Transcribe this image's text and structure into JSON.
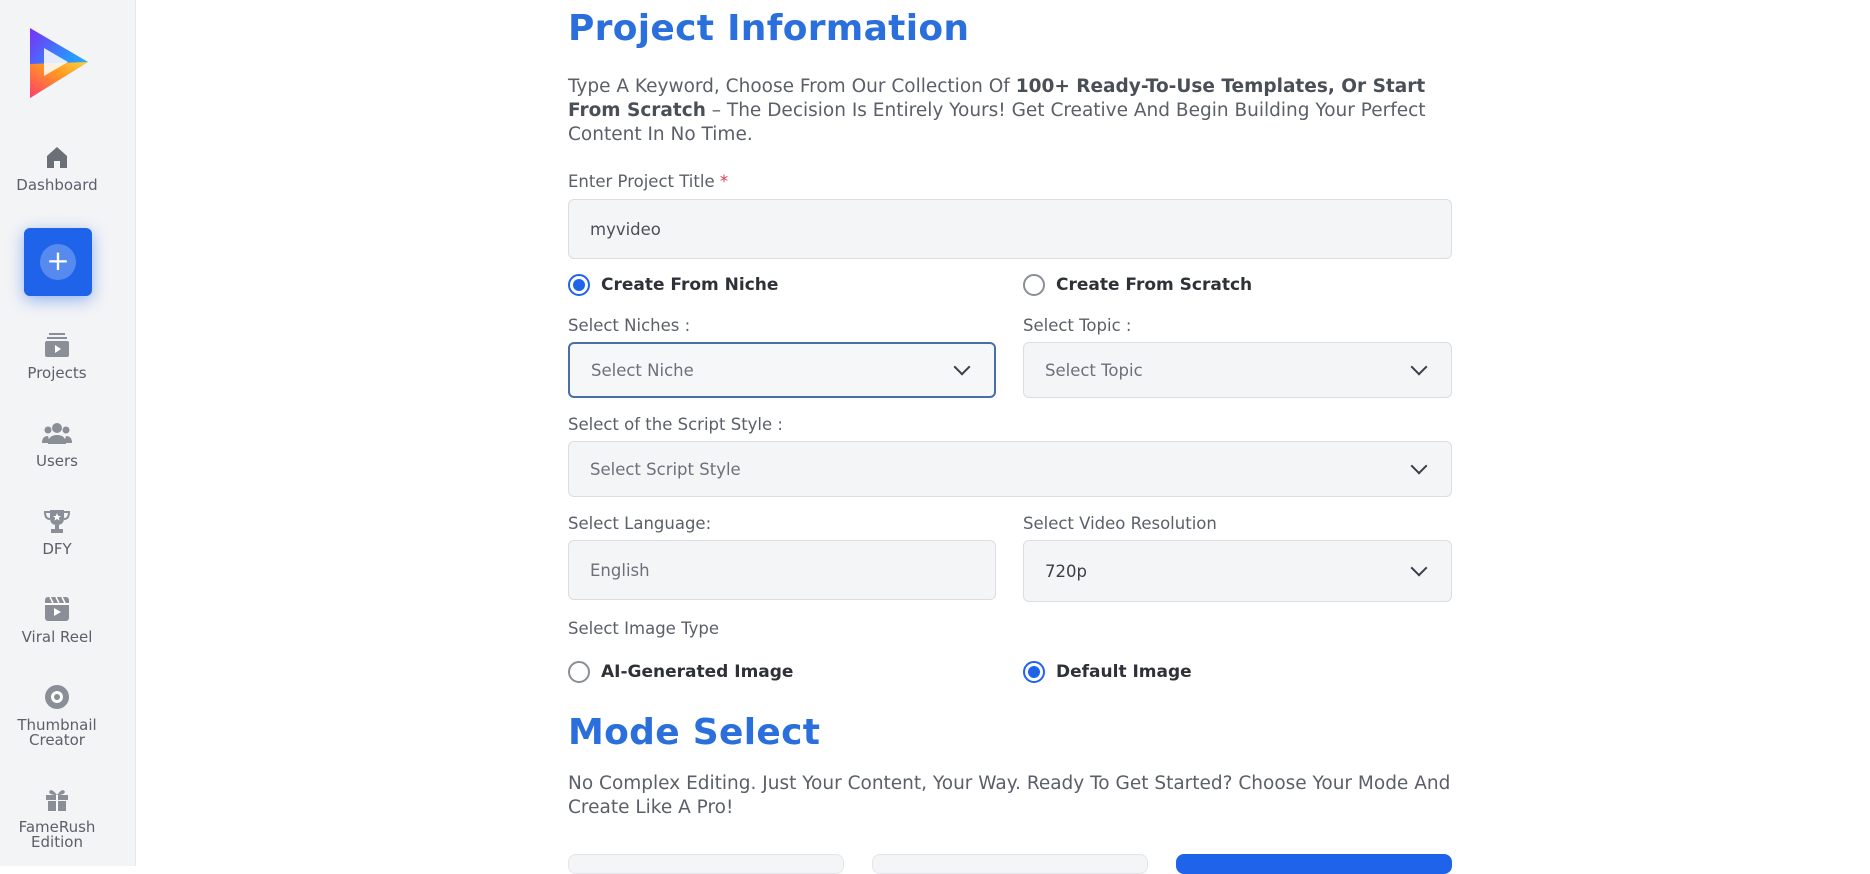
{
  "sidebar": {
    "items": [
      {
        "label": "Dashboard",
        "icon": "home-icon"
      },
      {
        "label": "Projects",
        "icon": "projects-icon"
      },
      {
        "label": "Users",
        "icon": "users-icon"
      },
      {
        "label": "DFY",
        "icon": "trophy-icon"
      },
      {
        "label": "Viral Reel",
        "icon": "reel-icon"
      },
      {
        "label": "Thumbnail Creator",
        "icon": "thumbnail-icon"
      },
      {
        "label": "FameRush Edition",
        "icon": "gift-icon"
      }
    ],
    "create_icon": "plus-icon"
  },
  "project_info": {
    "title": "Project Information",
    "desc_start": "Type A Keyword, Choose From Our Collection Of ",
    "desc_bold": "100+ Ready-To-Use Templates, Or Start From Scratch",
    "desc_end": " – The Decision Is Entirely Yours! Get Creative And Begin Building Your Perfect Content In No Time.",
    "title_label": "Enter Project Title",
    "required_mark": "*",
    "title_value": "myvideo",
    "radio_niche": "Create From Niche",
    "radio_scratch": "Create From Scratch",
    "niches_label": "Select Niches :",
    "niches_value": "Select Niche",
    "topic_label": "Select Topic :",
    "topic_value": "Select Topic",
    "script_label": "Select of the Script Style :",
    "script_value": "Select Script Style",
    "language_label": "Select Language:",
    "language_value": "English",
    "resolution_label": "Select Video Resolution",
    "resolution_value": "720p",
    "image_type_label": "Select Image Type",
    "radio_ai": "AI-Generated Image",
    "radio_default": "Default Image"
  },
  "mode_select": {
    "title": "Mode Select",
    "desc": "No Complex Editing. Just Your Content, Your Way. Ready To Get Started? Choose Your Mode And Create Like A Pro!"
  },
  "colors": {
    "accent": "#1e63ea",
    "heading": "#2a6fdb"
  }
}
